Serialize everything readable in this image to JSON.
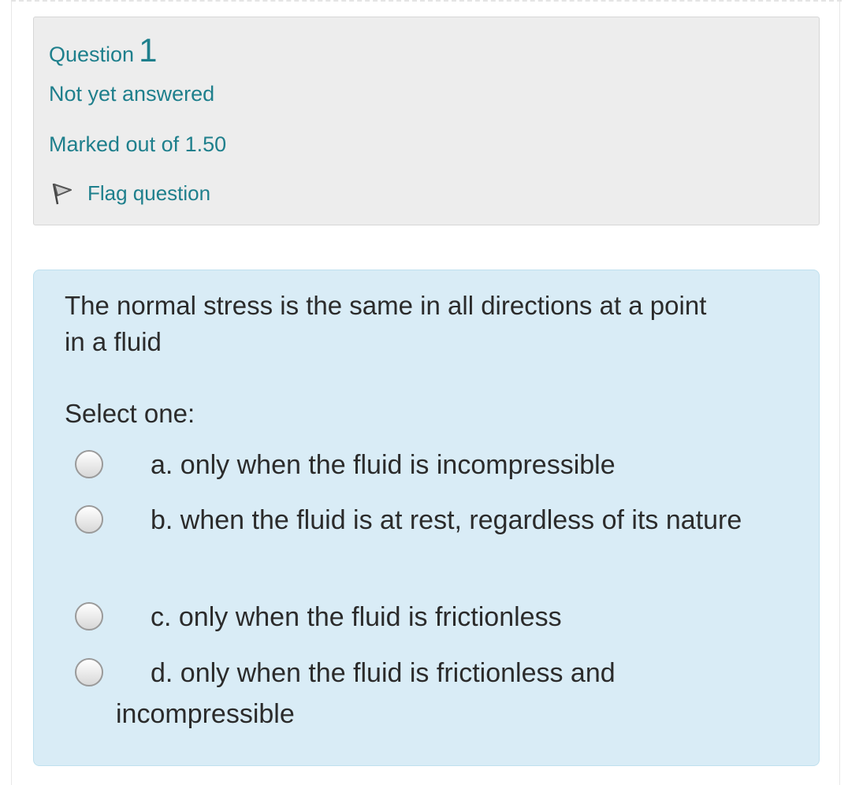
{
  "question_info": {
    "label": "Question",
    "number": "1",
    "state": "Not yet answered",
    "grade": "Marked out of 1.50",
    "flag_label": "Flag question",
    "flag_icon": "flag-icon"
  },
  "question": {
    "text": "The normal stress is the same in all directions at a point in a fluid",
    "prompt": "Select one:",
    "options": [
      {
        "letter": "a.",
        "text": "a. only when the fluid is incompressible"
      },
      {
        "letter": "b.",
        "text": "b. when the fluid is at rest, regardless of its nature"
      },
      {
        "letter": "c.",
        "text": "c. only when the fluid is frictionless"
      },
      {
        "letter": "d.",
        "text": "d. only when the fluid is frictionless and incompressible"
      }
    ]
  },
  "colors": {
    "link_teal": "#1e7f8c",
    "info_bg": "#ededed",
    "formulation_bg": "#d9ecf6",
    "formulation_border": "#bfe0ee",
    "text": "#2b2b2b"
  }
}
